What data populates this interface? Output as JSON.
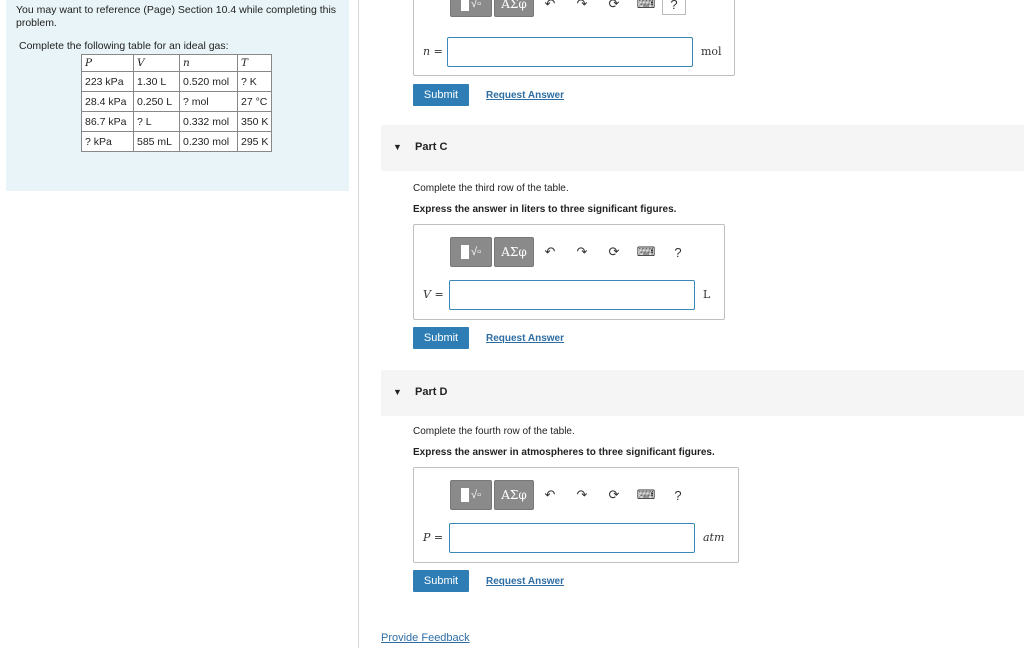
{
  "left": {
    "reference": "You may want to reference (Page) Section 10.4 while completing this problem.",
    "table_intro": "Complete the following table for an ideal gas:",
    "table": {
      "headers": [
        "P",
        "V",
        "n",
        "T"
      ],
      "rows": [
        [
          "223 kPa",
          "1.30 L",
          "0.520 mol",
          "? K"
        ],
        [
          "28.4 kPa",
          "0.250 L",
          "? mol",
          "27 °C"
        ],
        [
          "86.7 kPa",
          "? L",
          "0.332 mol",
          "350 K"
        ],
        [
          "? kPa",
          "585 mL",
          "0.230 mol",
          "295 K"
        ]
      ]
    }
  },
  "toolbar": {
    "greek": "ΑΣφ",
    "help": "?"
  },
  "partB": {
    "var_label": "n =",
    "unit": "mol",
    "submit": "Submit",
    "request": "Request Answer"
  },
  "partC": {
    "title": "Part C",
    "instruction": "Complete the third row of the table.",
    "express": "Express the answer in liters to three significant figures.",
    "var_label": "V =",
    "unit": "L",
    "submit": "Submit",
    "request": "Request Answer"
  },
  "partD": {
    "title": "Part D",
    "instruction": "Complete the fourth row of the table.",
    "express": "Express the answer in atmospheres to three significant figures.",
    "var_label": "P =",
    "unit": "atm",
    "submit": "Submit",
    "request": "Request Answer"
  },
  "feedback": "Provide Feedback"
}
